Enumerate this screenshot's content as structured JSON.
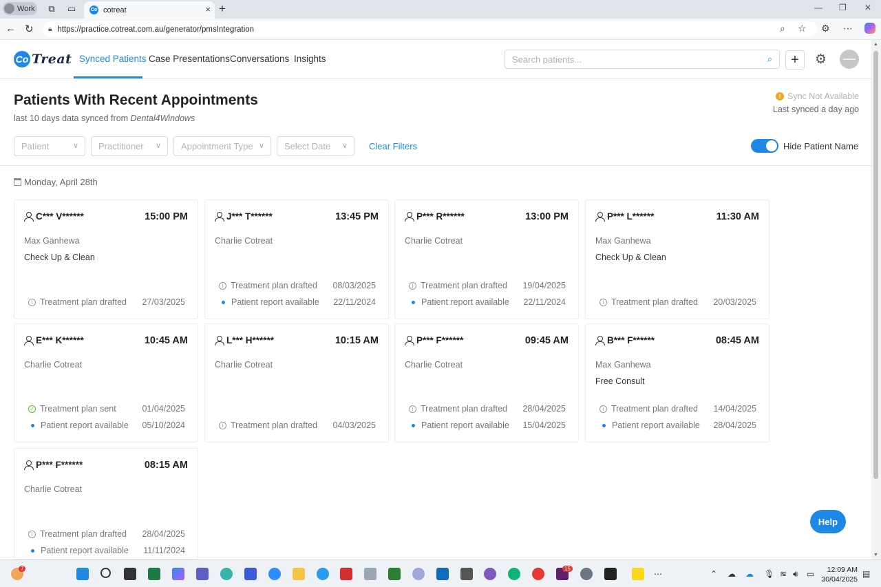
{
  "browser": {
    "profile_label": "Work",
    "tab_title": "cotreat",
    "tab_favicon": "Co",
    "url": "https://practice.cotreat.com.au/generator/pmsIntegration"
  },
  "app": {
    "logo_co": "Co",
    "logo_rest": "Treat",
    "nav": [
      "Synced Patients",
      "Case Presentations",
      "Conversations",
      "Insights"
    ],
    "search_placeholder": "Search patients...",
    "title": "Patients With Recent Appointments",
    "subtitle_prefix": "last 10 days data synced from ",
    "subtitle_source": "Dental4Windows",
    "sync_status": "Sync Not Available",
    "last_synced": "Last synced a day ago",
    "filters": [
      "Patient",
      "Practitioner",
      "Appointment Type",
      "Select Date"
    ],
    "clear_filters": "Clear Filters",
    "toggle_label": "Hide Patient Name",
    "toggle_on": true,
    "date_header": "Monday, April 28th",
    "help": "Help"
  },
  "cards": [
    {
      "patient": "C*** V******",
      "time": "15:00 PM",
      "practitioner": "Max Ganhewa",
      "appointment": "Check Up & Clean",
      "statuses": [
        {
          "icon": "info",
          "label": "Treatment plan drafted",
          "date": "27/03/2025"
        }
      ]
    },
    {
      "patient": "J*** T******",
      "time": "13:45 PM",
      "practitioner": "Charlie Cotreat",
      "appointment": "",
      "statuses": [
        {
          "icon": "info",
          "label": "Treatment plan drafted",
          "date": "08/03/2025"
        },
        {
          "icon": "dot",
          "label": "Patient report available",
          "date": "22/11/2024"
        }
      ]
    },
    {
      "patient": "P*** R******",
      "time": "13:00 PM",
      "practitioner": "Charlie Cotreat",
      "appointment": "",
      "statuses": [
        {
          "icon": "info",
          "label": "Treatment plan drafted",
          "date": "19/04/2025"
        },
        {
          "icon": "dot",
          "label": "Patient report available",
          "date": "22/11/2024"
        }
      ]
    },
    {
      "patient": "P*** L******",
      "time": "11:30 AM",
      "practitioner": "Max Ganhewa",
      "appointment": "Check Up & Clean",
      "statuses": [
        {
          "icon": "info",
          "label": "Treatment plan drafted",
          "date": "20/03/2025"
        }
      ]
    },
    {
      "patient": "E*** K******",
      "time": "10:45 AM",
      "practitioner": "Charlie Cotreat",
      "appointment": "",
      "statuses": [
        {
          "icon": "check",
          "label": "Treatment plan sent",
          "date": "01/04/2025"
        },
        {
          "icon": "dot",
          "label": "Patient report available",
          "date": "05/10/2024"
        }
      ]
    },
    {
      "patient": "L*** H******",
      "time": "10:15 AM",
      "practitioner": "Charlie Cotreat",
      "appointment": "",
      "statuses": [
        {
          "icon": "info",
          "label": "Treatment plan drafted",
          "date": "04/03/2025"
        }
      ]
    },
    {
      "patient": "P*** F******",
      "time": "09:45 AM",
      "practitioner": "Charlie Cotreat",
      "appointment": "",
      "statuses": [
        {
          "icon": "info",
          "label": "Treatment plan drafted",
          "date": "28/04/2025"
        },
        {
          "icon": "dot",
          "label": "Patient report available",
          "date": "15/04/2025"
        }
      ]
    },
    {
      "patient": "B*** F******",
      "time": "08:45 AM",
      "practitioner": "Max Ganhewa",
      "appointment": "Free Consult",
      "statuses": [
        {
          "icon": "info",
          "label": "Treatment plan drafted",
          "date": "14/04/2025"
        },
        {
          "icon": "dot",
          "label": "Patient report available",
          "date": "28/04/2025"
        }
      ]
    },
    {
      "patient": "P*** F******",
      "time": "08:15 AM",
      "practitioner": "Charlie Cotreat",
      "appointment": "",
      "statuses": [
        {
          "icon": "info",
          "label": "Treatment plan drafted",
          "date": "28/04/2025"
        },
        {
          "icon": "dot",
          "label": "Patient report available",
          "date": "11/11/2024"
        }
      ]
    }
  ],
  "taskbar": {
    "clock_time": "12:09 AM",
    "clock_date": "30/04/2025",
    "badge_notifications": "7",
    "badge_slack": "15"
  },
  "colors": {
    "accent": "#1e88e5",
    "warning": "#f5a623",
    "success": "#52c41a"
  }
}
